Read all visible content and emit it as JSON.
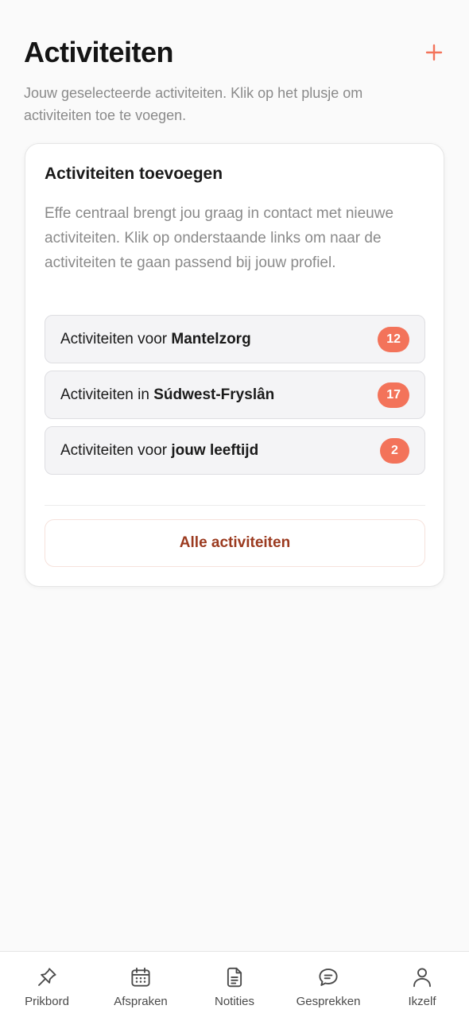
{
  "header": {
    "title": "Activiteiten",
    "add_icon": "plus-icon",
    "subtitle": "Jouw geselecteerde activiteiten. Klik op het plusje om activiteiten toe te voegen."
  },
  "card": {
    "title": "Activiteiten toevoegen",
    "text": "Effe centraal brengt jou graag in contact met nieuwe activiteiten. Klik op onderstaande links om naar de activiteiten te gaan passend bij jouw profiel.",
    "links": [
      {
        "prefix": "Activiteiten voor ",
        "bold": "Mantelzorg",
        "count": "12"
      },
      {
        "prefix": "Activiteiten in ",
        "bold": "Súdwest-Fryslân",
        "count": "17"
      },
      {
        "prefix": "Activiteiten voor ",
        "bold": "jouw leeftijd",
        "count": "2"
      }
    ],
    "all_button": "Alle activiteiten"
  },
  "tabbar": {
    "tabs": [
      {
        "label": "Prikbord",
        "icon": "pin-icon"
      },
      {
        "label": "Afspraken",
        "icon": "calendar-icon"
      },
      {
        "label": "Notities",
        "icon": "document-icon"
      },
      {
        "label": "Gesprekken",
        "icon": "chat-bubble-icon"
      },
      {
        "label": "Ikzelf",
        "icon": "person-icon"
      }
    ]
  },
  "colors": {
    "accent": "#f3735a",
    "button_text": "#9b3a1f",
    "muted_text": "#8a8a8a",
    "background": "#fafafa"
  }
}
